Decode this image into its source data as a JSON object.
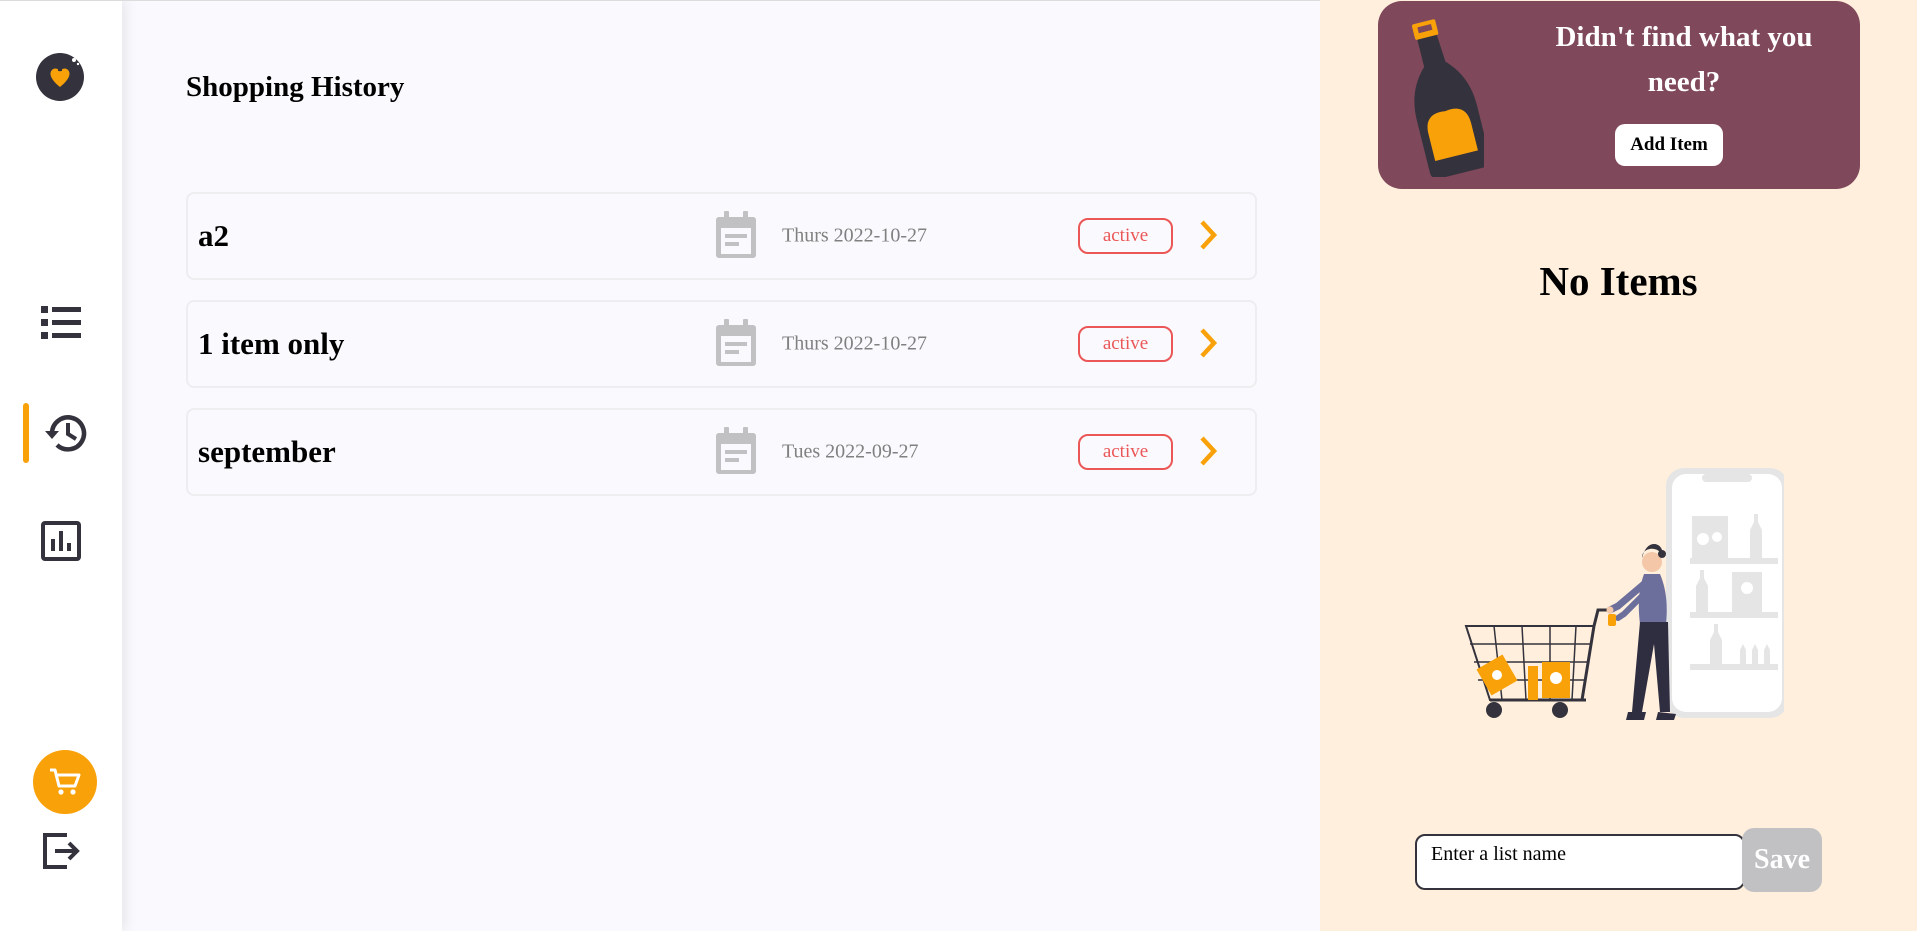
{
  "sidebar": {
    "logo_icon": "heart-bottle-logo-icon",
    "nav": [
      {
        "id": "items",
        "icon": "list-icon",
        "active": false
      },
      {
        "id": "history",
        "icon": "history-icon",
        "active": true
      },
      {
        "id": "statistics",
        "icon": "bar-chart-icon",
        "active": false
      }
    ],
    "cart_icon": "cart-icon",
    "logout_icon": "logout-icon"
  },
  "main": {
    "title": "Shopping History",
    "history": [
      {
        "name": "a2",
        "date": "Thurs 2022-10-27",
        "status": "active"
      },
      {
        "name": "1 item only",
        "date": "Thurs 2022-10-27",
        "status": "active"
      },
      {
        "name": "september",
        "date": "Tues 2022-09-27",
        "status": "active"
      }
    ]
  },
  "panel": {
    "banner_text": "Didn't find what you need?",
    "add_item_label": "Add Item",
    "empty_text": "No Items",
    "input_placeholder": "Enter a list name",
    "save_label": "Save"
  },
  "colors": {
    "accent": "#f9a109",
    "banner": "#80485b",
    "panel_bg": "#ffefdc",
    "badge": "#eb5757",
    "dark": "#34333d"
  }
}
